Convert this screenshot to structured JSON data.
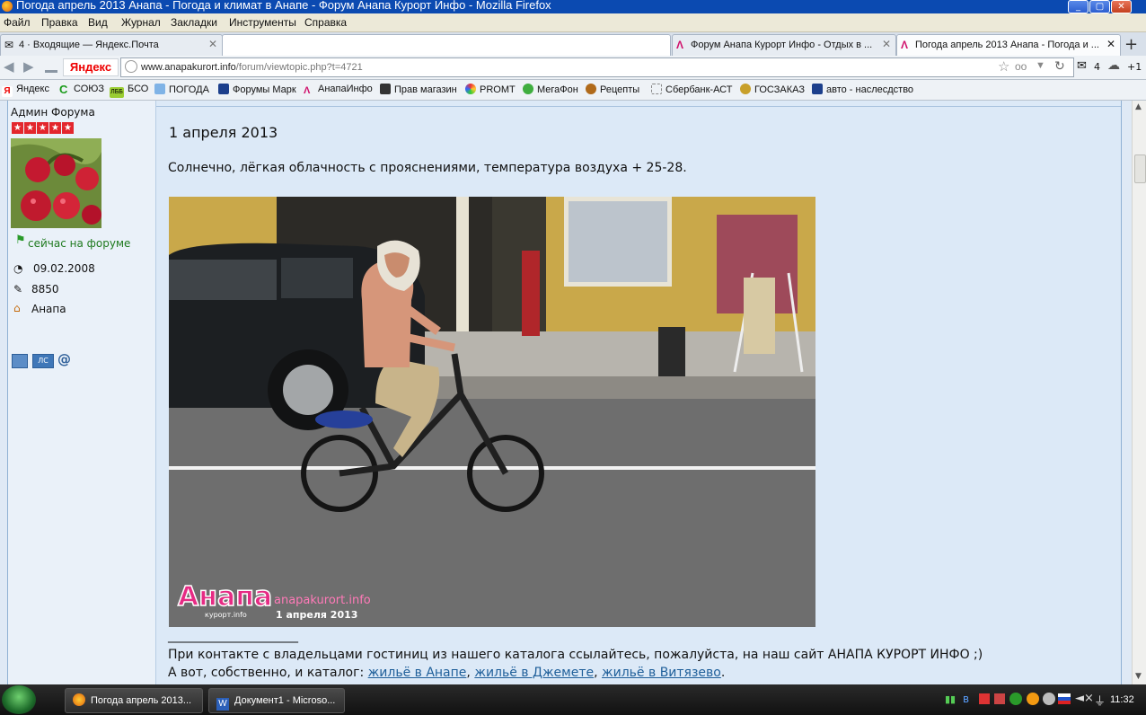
{
  "window": {
    "title": "Погода апрель 2013 Анапа - Погода и климат в Анапе - Форум Анапа Курорт Инфо - Mozilla Firefox"
  },
  "menu": [
    "Файл",
    "Правка",
    "Вид",
    "Журнал",
    "Закладки",
    "Инструменты",
    "Справка"
  ],
  "tabs": [
    {
      "label": "4 · Входящие — Яндекс.Почта",
      "icon": "mail-icon"
    },
    {
      "label": "",
      "icon": ""
    },
    {
      "label": "Форум Анапа Курорт Инфо - Отдых в ...",
      "icon": "anapa-logo-icon"
    },
    {
      "label": "Погода апрель 2013 Анапа - Погода и ...",
      "icon": "anapa-logo-icon",
      "active": true
    }
  ],
  "nav": {
    "yandex": "Яндекс",
    "url_domain": "www.anapakurort.info",
    "url_path": "/forum/viewtopic.php?t=4721",
    "mail_count": "4",
    "weather": "+1"
  },
  "bookmarks": [
    "Яндекс",
    "СОЮЗ",
    "БСО",
    "ПОГОДА",
    "Форумы Марк",
    "АнапаИнфо",
    "Прав магазин",
    "PROMT",
    "МегаФон",
    "Рецепты",
    "Сбербанк-АСТ",
    "ГОСЗАКАЗ",
    "авто - наслесдство"
  ],
  "bookmark_badges": {
    "soyuz": "С",
    "bso": "ЛББ"
  },
  "user": {
    "rank": "Админ Форума",
    "stars": 5,
    "status": "сейчас на форуме",
    "joined": "09.02.2008",
    "posts": "8850",
    "location": "Анапа",
    "pm_label": "ЛС",
    "email_label": "@"
  },
  "post": {
    "date": "1 апреля 2013",
    "weather_text": "Солнечно, лёгкая облачность с прояснениями, температура воздуха + 25-28.",
    "photo_watermark": {
      "logo": "Анапа",
      "logo_sub": "курорт.info",
      "site": "anapakurort.info",
      "date": "1 апреля 2013"
    },
    "signature_rule": "________________________",
    "signature_line1": "При контакте с владельцами гостиниц из нашего каталога ссылайтесь, пожалуйста, на наш сайт АНАПА КУРОРТ ИНФО ;)",
    "signature_prefix": "А вот, собственно, и каталог:",
    "links": [
      "жильё в Анапе",
      "жильё в Джемете",
      "жильё в Витязево"
    ],
    "sep": ",",
    "end": "."
  },
  "taskbar": {
    "items": [
      "Погода апрель 2013...",
      "Документ1 - Microso..."
    ],
    "clock": "11:32"
  },
  "colors": {
    "titlebar": "#0b4ab1",
    "post_bg": "#dce9f7",
    "link": "#1f5f9a"
  }
}
